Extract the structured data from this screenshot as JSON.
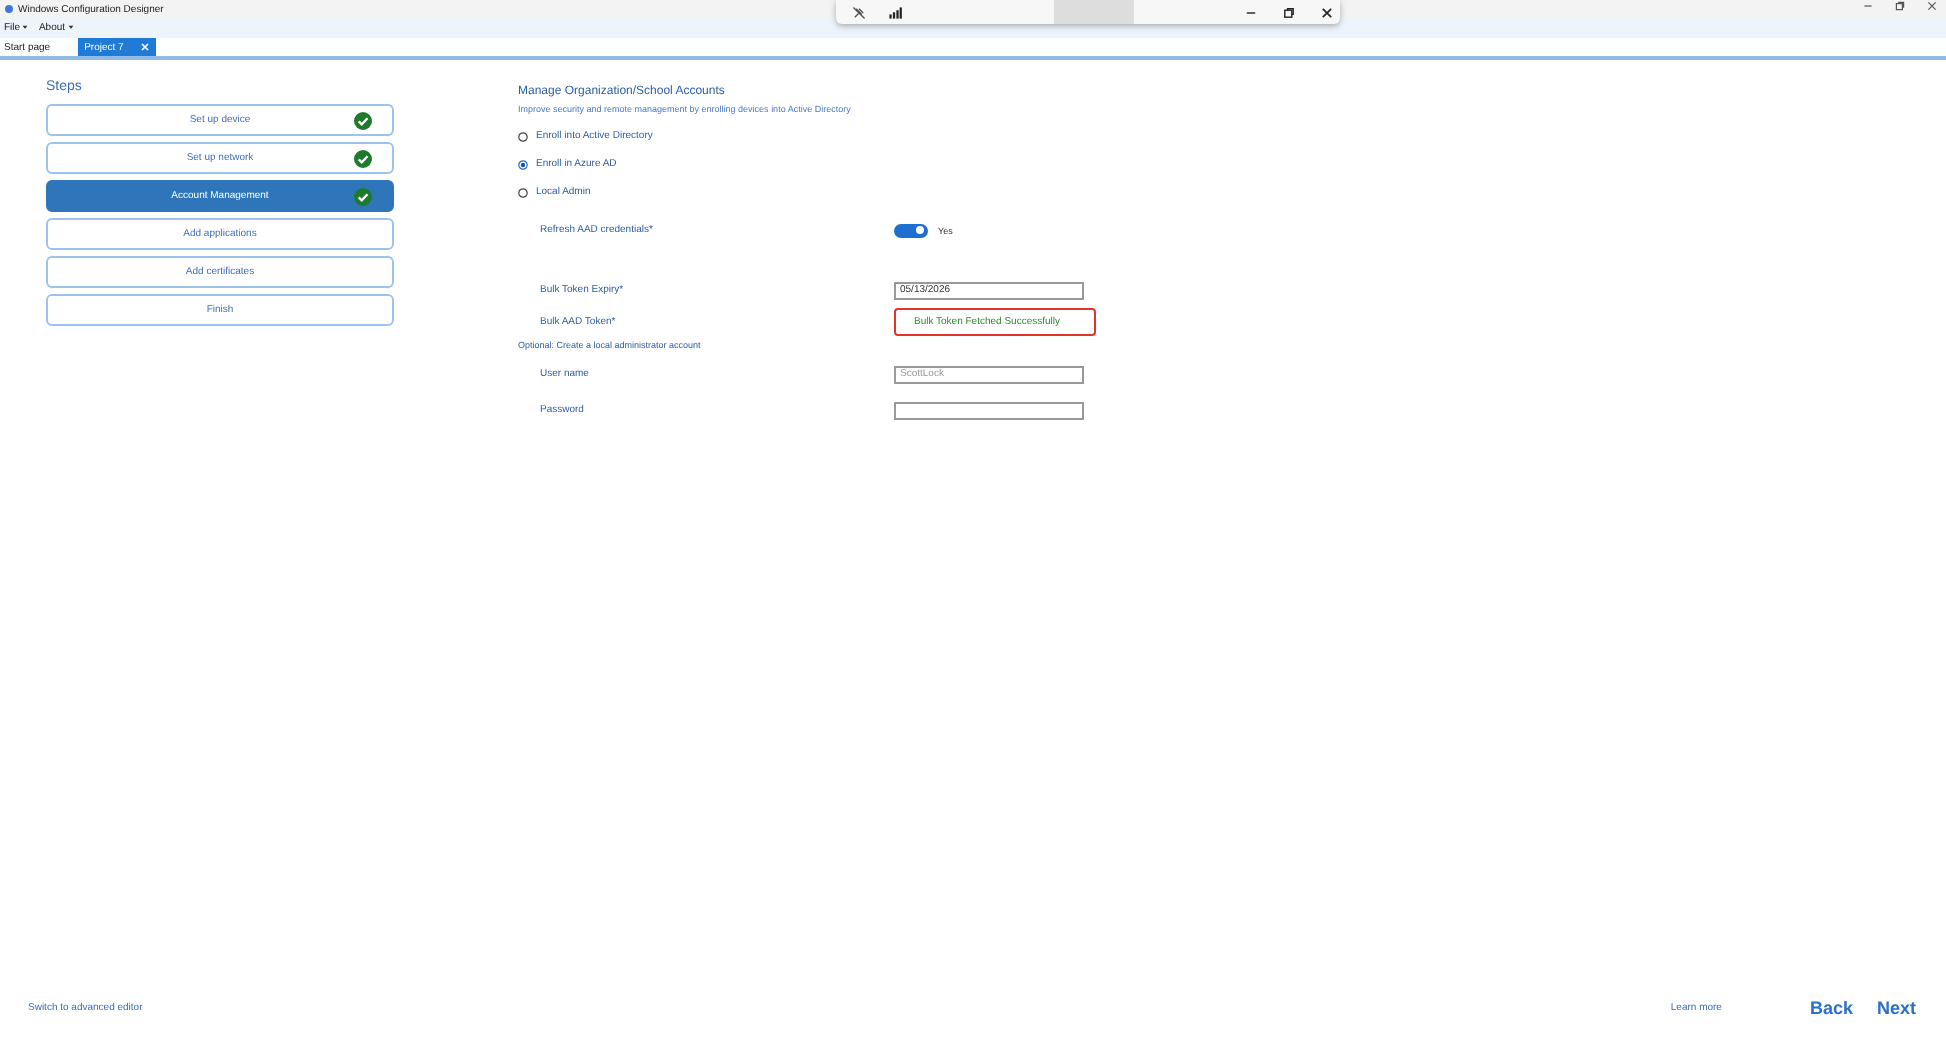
{
  "window": {
    "title": "Windows Configuration Designer"
  },
  "menu": [
    {
      "label": "File"
    },
    {
      "label": "About"
    }
  ],
  "tabs": [
    {
      "label": "Start page",
      "selected": false,
      "closable": false
    },
    {
      "label": "Project 7",
      "selected": true,
      "closable": true
    }
  ],
  "steps_title": "Steps",
  "steps": [
    {
      "label": "Set up device",
      "done": true,
      "selected": false
    },
    {
      "label": "Set up network",
      "done": true,
      "selected": false
    },
    {
      "label": "Account Management",
      "done": true,
      "selected": true
    },
    {
      "label": "Add applications",
      "done": false,
      "selected": false
    },
    {
      "label": "Add certificates",
      "done": false,
      "selected": false
    },
    {
      "label": "Finish",
      "done": false,
      "selected": false
    }
  ],
  "section": {
    "title": "Manage Organization/School Accounts",
    "subtitle": "Improve security and remote management by enrolling devices into Active Directory"
  },
  "options": [
    {
      "label": "Enroll into Active Directory",
      "selected": false
    },
    {
      "label": "Enroll in Azure AD",
      "selected": true
    },
    {
      "label": "Local Admin",
      "selected": false
    }
  ],
  "refresh": {
    "label": "Refresh AAD credentials*",
    "on": true,
    "state_label": "Yes"
  },
  "expiry": {
    "label": "Bulk Token Expiry*",
    "value": "05/13/2026"
  },
  "token": {
    "label": "Bulk AAD Token*",
    "status": "Bulk Token Fetched Successfully"
  },
  "optional": "Optional: Create a local administrator account",
  "fields": [
    {
      "label": "User name",
      "placeholder": "ScottLock"
    },
    {
      "label": "Password"
    }
  ],
  "footer": {
    "advanced": "Switch to advanced editor",
    "learn": "Learn more",
    "back": "Back",
    "next": "Next"
  }
}
